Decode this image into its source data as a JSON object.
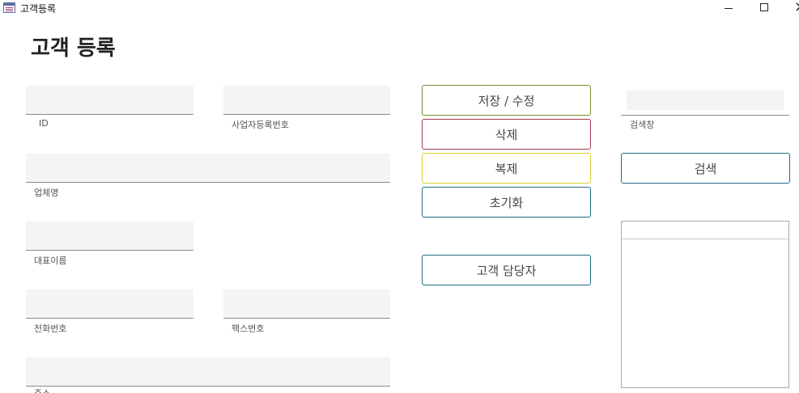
{
  "window": {
    "title": "고객등록",
    "controls": [
      "minimize-icon",
      "maximize-icon",
      "close-icon"
    ]
  },
  "page": {
    "title": "고객 등록"
  },
  "fields": {
    "id": {
      "label": "ID",
      "value": ""
    },
    "business_number": {
      "label": "사업자등록번호",
      "value": ""
    },
    "company_name": {
      "label": "업체명",
      "value": ""
    },
    "representative": {
      "label": "대표이름",
      "value": ""
    },
    "phone": {
      "label": "전화번호",
      "value": ""
    },
    "fax": {
      "label": "팩스번호",
      "value": ""
    },
    "address": {
      "label": "주소",
      "value": ""
    }
  },
  "actions": {
    "save": "저장 / 수정",
    "delete": "삭제",
    "copy": "복제",
    "reset": "초기화",
    "contacts": "고객 담당자"
  },
  "search": {
    "label": "검색창",
    "value": "",
    "button": "검색"
  },
  "results": {
    "items": []
  },
  "colors": {
    "accent": "#1f6b85",
    "save_border": "#7f8a2a",
    "delete_border": "#a43a4c",
    "copy_border": "#d8cf2a",
    "field_bg": "#f4f4f4"
  }
}
